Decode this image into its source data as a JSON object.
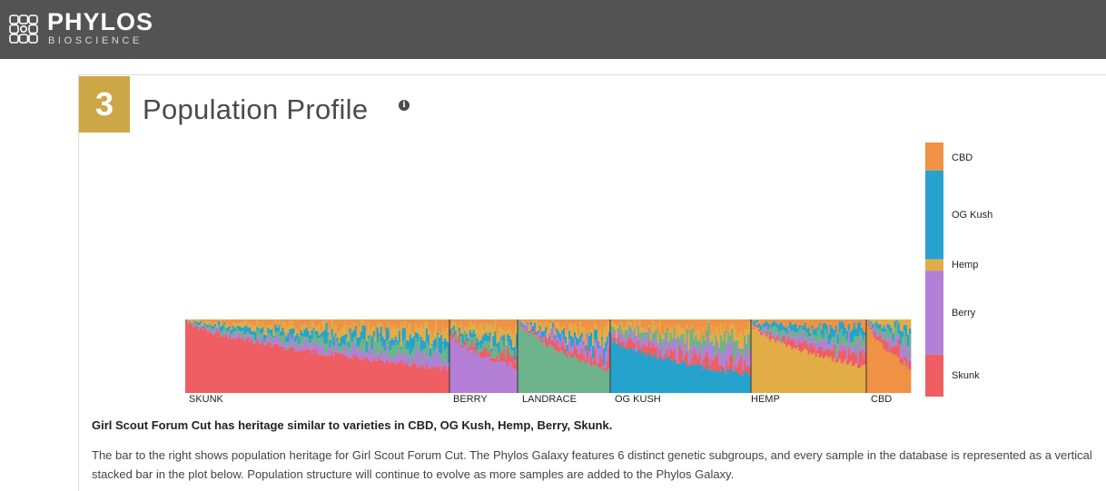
{
  "header": {
    "brand_name": "PHYLOS",
    "brand_sub": "BIOSCIENCE",
    "logo_icon": "lattice-logo-icon",
    "bg_color": "#535353"
  },
  "section": {
    "number": "3",
    "title": "Population Profile",
    "info_icon_glyph": "i",
    "badge_color": "#cda647"
  },
  "colors": {
    "Skunk": "#ef5e62",
    "Berry": "#b47fd6",
    "Landrace": "#6db38c",
    "OG Kush": "#25a3cd",
    "Hemp": "#e2ac47",
    "CBD": "#f09244"
  },
  "chart_data": {
    "type": "bar",
    "stacked": true,
    "ylim": [
      0,
      1
    ],
    "groups": [
      "SKUNK",
      "BERRY",
      "LANDRACE",
      "OG KUSH",
      "HEMP",
      "CBD"
    ],
    "group_sample_counts": [
      145,
      38,
      51,
      78,
      63,
      24
    ],
    "dominant_fraction_start": [
      1.0,
      0.8,
      1.0,
      0.75,
      0.95,
      1.0
    ],
    "dominant_fraction_end": [
      0.33,
      0.35,
      0.3,
      0.25,
      0.35,
      0.35
    ],
    "sample_legend": [
      {
        "name": "CBD",
        "fraction": 0.11
      },
      {
        "name": "OG Kush",
        "fraction": 0.35
      },
      {
        "name": "Hemp",
        "fraction": 0.045
      },
      {
        "name": "Berry",
        "fraction": 0.33
      },
      {
        "name": "Skunk",
        "fraction": 0.165
      }
    ]
  },
  "text": {
    "summary": "Girl Scout Forum Cut has heritage similar to varieties in CBD, OG Kush, Hemp, Berry, Skunk.",
    "description": "The bar to the right shows population heritage for Girl Scout Forum Cut. The Phylos Galaxy features 6 distinct genetic subgroups, and every sample in the database is represented as a vertical stacked bar in the plot below. Population structure will continue to evolve as more samples are added to the Phylos Galaxy."
  }
}
